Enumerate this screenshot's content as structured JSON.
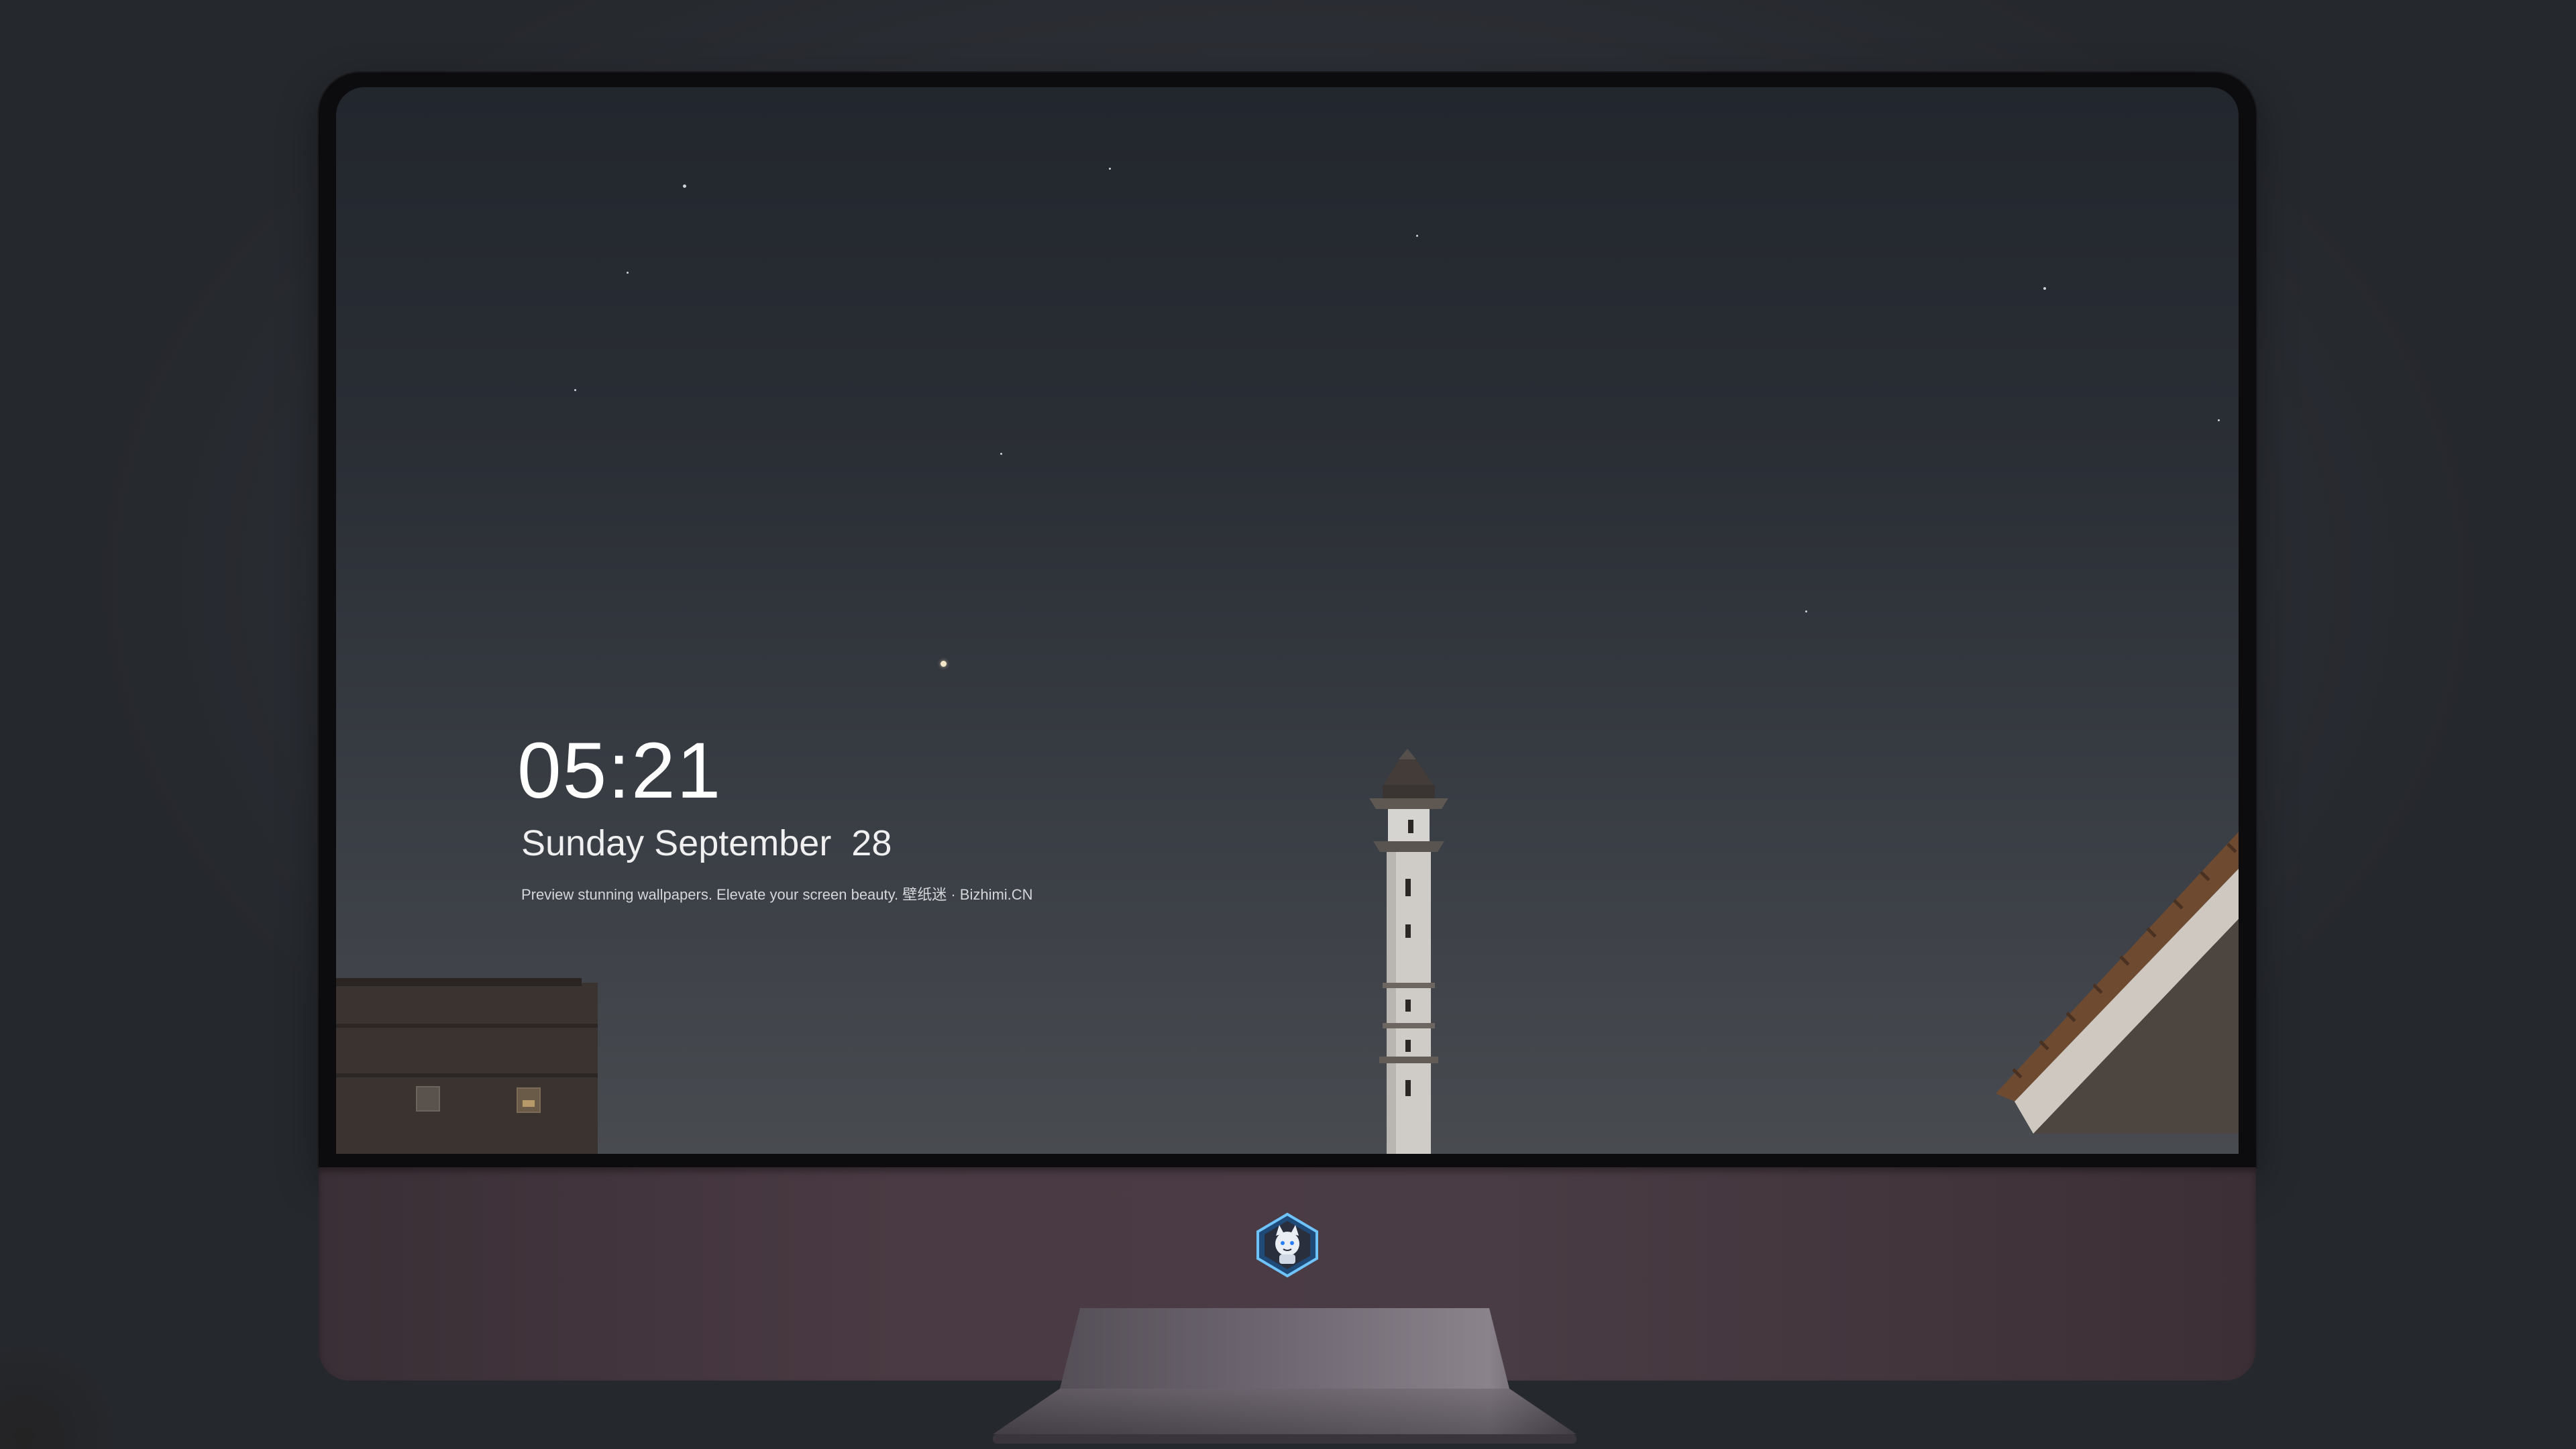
{
  "lockscreen": {
    "time": "05:21",
    "date": "Sunday September  28",
    "tagline": "Preview stunning wallpapers. Elevate your screen beauty. 壁纸迷 · Bizhimi.CN"
  },
  "dock": {
    "items": [
      {
        "name": "messages-icon",
        "color": "#34c759"
      },
      {
        "name": "weather-icon",
        "color": "#2d8cf0"
      },
      {
        "name": "clock-icon",
        "color": "#1c1c1e"
      },
      {
        "name": "preview-icon",
        "color": "#f2c94c"
      },
      {
        "name": "clips-icon",
        "color": "#5ac8fa"
      },
      {
        "name": "notes-icon",
        "color": "#ffd60a"
      },
      {
        "name": "photo-booth-icon",
        "color": "#e8e8e8"
      },
      {
        "name": "itunes-icon",
        "color": "#d94bd1"
      },
      {
        "name": "app-store-icon",
        "color": "#1a8cff"
      },
      {
        "name": "camera-icon",
        "color": "#8e8e93"
      }
    ]
  },
  "colors": {
    "sky_top": "#22262d",
    "sky_bottom": "#484b50",
    "chin": "#4a3a43",
    "bezel": "#0c0c0e"
  }
}
